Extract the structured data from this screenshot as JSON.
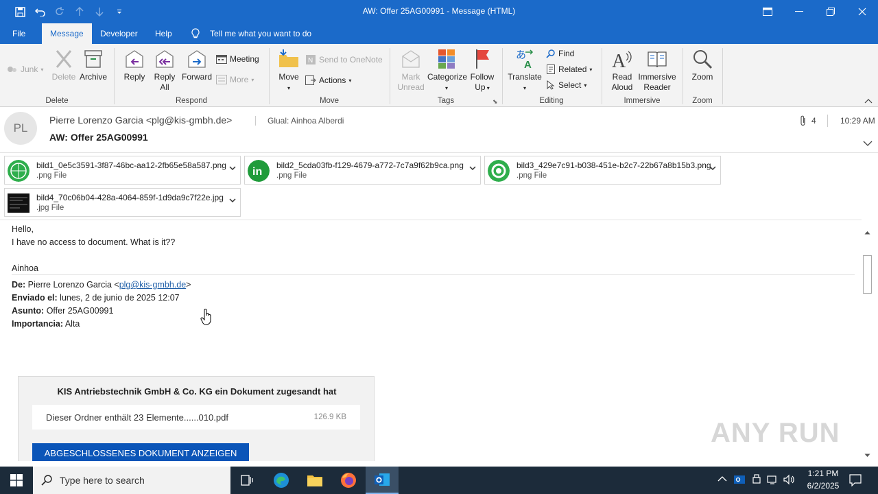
{
  "window": {
    "title": "AW: Offer 25AG00991  -  Message (HTML)"
  },
  "menu": {
    "tabs": [
      "File",
      "Message",
      "Developer",
      "Help"
    ],
    "tell_me": "Tell me what you want to do"
  },
  "ribbon": {
    "junk": "Junk",
    "delete": "Delete",
    "archive": "Archive",
    "reply": "Reply",
    "reply_all_1": "Reply",
    "reply_all_2": "All",
    "forward": "Forward",
    "meeting": "Meeting",
    "more": "More",
    "move": "Move",
    "send_onenote": "Send to OneNote",
    "actions": "Actions",
    "mark_unread_1": "Mark",
    "mark_unread_2": "Unread",
    "categorize": "Categorize",
    "follow_up_1": "Follow",
    "follow_up_2": "Up",
    "translate": "Translate",
    "find": "Find",
    "related": "Related",
    "select": "Select",
    "read_aloud_1": "Read",
    "read_aloud_2": "Aloud",
    "immersive_1": "Immersive",
    "immersive_2": "Reader",
    "zoom": "Zoom",
    "groups": {
      "delete": "Delete",
      "respond": "Respond",
      "move": "Move",
      "tags": "Tags",
      "editing": "Editing",
      "immersive": "Immersive",
      "zoom": "Zoom"
    }
  },
  "message": {
    "avatar_initials": "PL",
    "from": "Pierre Lorenzo Garcia <plg@kis-gmbh.de>",
    "to": "Glual: Ainhoa Alberdi",
    "subject": "AW: Offer 25AG00991",
    "attachment_count": "4",
    "time": "10:29 AM"
  },
  "attachments": [
    {
      "name": "bild1_0e5c3591-3f87-46bc-aa12-2fb65e58a587.png",
      "type": ".png File",
      "color": "#2eae4c"
    },
    {
      "name": "bild2_5cda03fb-f129-4679-a772-7c7a9f62b9ca.png",
      "type": ".png File",
      "color": "#1f9b3a"
    },
    {
      "name": "bild3_429e7c91-b038-451e-b2c7-22b67a8b15b3.png",
      "type": ".png File",
      "color": "#2eae4c"
    },
    {
      "name": "bild4_70c06b04-428a-4064-859f-1d9da9c7f22e.jpg",
      "type": ".jpg File",
      "color": "#111111"
    }
  ],
  "body": {
    "greeting": "Hello,",
    "line1": "I have no access to document. What is it??",
    "signature": "Ainhoa",
    "de_label": "De:",
    "de_value": "Pierre Lorenzo Garcia <",
    "de_email": "plg@kis-gmbh.de",
    "de_close": ">",
    "enviado_label": "Enviado el:",
    "enviado_value": "lunes, 2 de junio de 2025 12:07",
    "asunto_label": "Asunto:",
    "asunto_value": "Offer 25AG00991",
    "importancia_label": "Importancia:",
    "importancia_value": "Alta",
    "card_title": "KIS Antriebstechnik GmbH & Co. KG ein Dokument zugesandt hat",
    "card_file": "Dieser Ordner enthält 23 Elemente......010.pdf",
    "card_size": "126.9 KB",
    "card_button": "ABGESCHLOSSENES DOKUMENT ANZEIGEN"
  },
  "taskbar": {
    "search_placeholder": "Type here to search",
    "time": "1:21 PM",
    "date": "6/2/2025"
  },
  "watermark": "ANY RUN",
  "colors": {
    "accent": "#1b6ac9",
    "taskbar": "#1c2b3a",
    "button_blue": "#0b55b8"
  }
}
